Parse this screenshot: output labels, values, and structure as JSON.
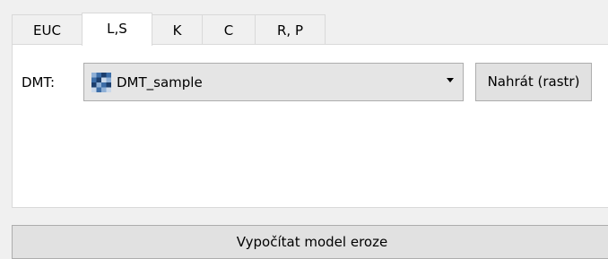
{
  "tabs": [
    {
      "label": "EUC",
      "active": false
    },
    {
      "label": "L,S",
      "active": true
    },
    {
      "label": "K",
      "active": false
    },
    {
      "label": "C",
      "active": false
    },
    {
      "label": "R, P",
      "active": false
    }
  ],
  "dmt": {
    "label": "DMT:",
    "selected_layer": "DMT_sample",
    "layer_icon": "raster-layer-icon",
    "load_button": "Nahrát (rastr)"
  },
  "compute_button": "Vypočítat model eroze",
  "colors": {
    "raster_dark": "#1c3f6e",
    "raster_mid": "#3d6ea8",
    "raster_light": "#8fb0d6",
    "raster_pale": "#c9d8ea"
  }
}
